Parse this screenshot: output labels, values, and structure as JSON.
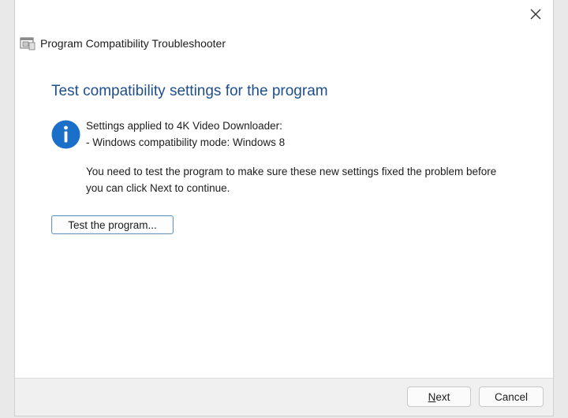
{
  "window": {
    "title": "Program Compatibility Troubleshooter",
    "close_icon": "close-icon"
  },
  "main": {
    "heading": "Test compatibility settings for the program",
    "info_icon": "info-icon",
    "info_color": "#1a6fc9",
    "settings_line": "Settings applied to 4K Video Downloader:",
    "mode_line": "- Windows compatibility mode: Windows 8",
    "instruction_line1": "You need to test the program to make sure these new settings fixed the problem before",
    "instruction_line2": "you can click Next to continue.",
    "test_button_label": "Test the program..."
  },
  "footer": {
    "next_mnemonic": "N",
    "next_rest": "ext",
    "cancel_label": "Cancel"
  },
  "colors": {
    "heading": "#1e4e8c",
    "footer_bg": "#f0f0f0"
  }
}
